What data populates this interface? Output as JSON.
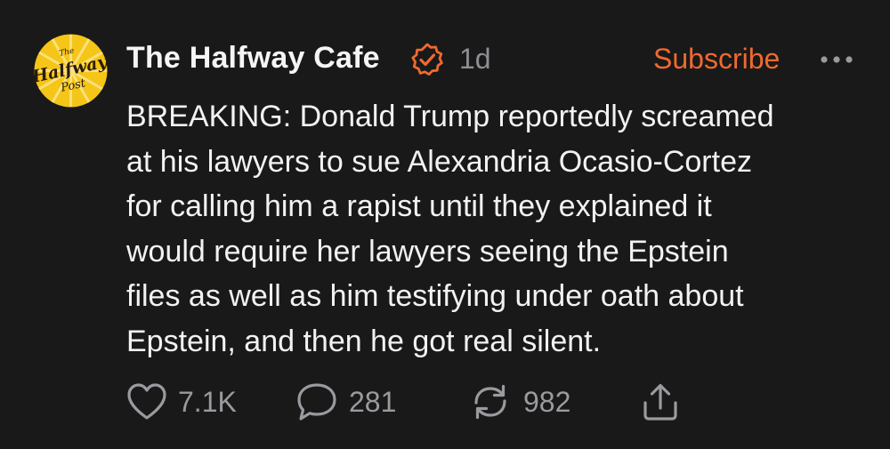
{
  "post": {
    "avatar_logo_text": [
      "The",
      "Halfway",
      "Post"
    ],
    "author": "The Halfway Cafe",
    "time": "1d",
    "subscribe_label": "Subscribe",
    "body_lines": [
      "BREAKING: Donald Trump reportedly screamed",
      "at his lawyers to sue Alexandria Ocasio-Cortez",
      "for calling him a rapist until they explained it",
      "would require her lawyers seeing the Epstein",
      "files as well as him testifying under oath about",
      "Epstein, and then he got real silent."
    ],
    "actions": {
      "likes": "7.1K",
      "comments": "281",
      "reposts": "982"
    }
  },
  "colors": {
    "background": "#19191a",
    "accent": "#ef6a2e",
    "muted": "#8e8e93",
    "text": "#f2f2f2",
    "avatar_yellow": "#f5c518"
  },
  "icons": [
    "verified-badge-icon",
    "more-options-icon",
    "heart-icon",
    "comment-icon",
    "repost-icon",
    "share-icon"
  ]
}
